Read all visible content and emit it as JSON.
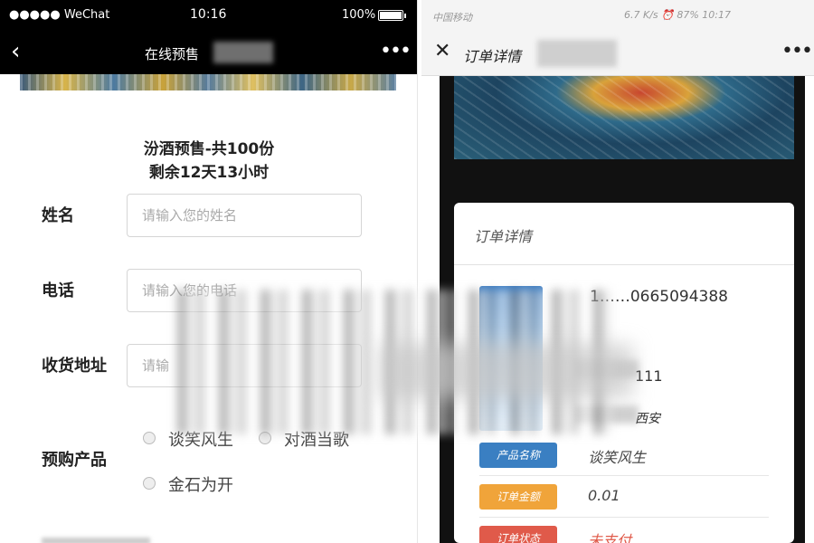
{
  "left": {
    "status": {
      "carrier": "●●●●● WeChat",
      "time": "10:16",
      "battery": "100%"
    },
    "nav": {
      "back_icon": "‹",
      "title": "在线预售",
      "more_icon": "•••"
    },
    "header": {
      "line1": "汾酒预售-共100份",
      "line2": "剩余12天13小时"
    },
    "form": {
      "name_label": "姓名",
      "name_placeholder": "请输入您的姓名",
      "phone_label": "电话",
      "phone_placeholder": "请输入您的电话",
      "address_label": "收货地址",
      "address_placeholder": "请输",
      "product_label": "预购产品",
      "options": [
        "谈笑风生",
        "对酒当歌",
        "金石为开"
      ]
    }
  },
  "right": {
    "status": {
      "carrier": "中国移动",
      "icons": "6.7 K/s  ⏰  87%  10:17"
    },
    "nav": {
      "close_icon": "✕",
      "title": "订单详情",
      "more_icon": "•••"
    },
    "card": {
      "title": "订单详情",
      "order_no": "1……0665094388",
      "val_2": "111",
      "val_3": "西安",
      "rows": [
        {
          "tag": "产品名称",
          "value": "谈笑风生",
          "color": "#3a7fc2"
        },
        {
          "tag": "订单金额",
          "value": "0.01",
          "color": "#f0a43a"
        },
        {
          "tag": "订单状态",
          "value": "未支付",
          "color": "#e05a4a"
        }
      ]
    }
  }
}
